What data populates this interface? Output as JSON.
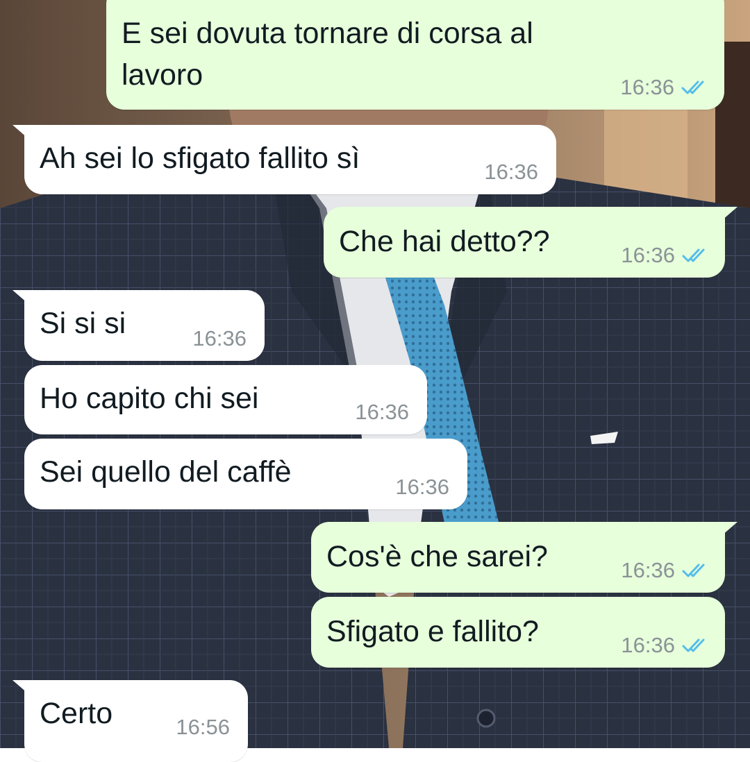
{
  "colors": {
    "outgoing_bubble": "#e7ffdb",
    "incoming_bubble": "#ffffff",
    "read_ticks": "#53bdeb",
    "timestamp": "#8a9296"
  },
  "messages": [
    {
      "direction": "out",
      "text_line1": "E sei dovuta tornare di corsa al",
      "text_line2": "lavoro",
      "time": "16:36",
      "status": "read",
      "status_icon": "double-check-icon"
    },
    {
      "direction": "in",
      "text": "Ah sei lo sfigato fallito sì",
      "time": "16:36"
    },
    {
      "direction": "out",
      "text": "Che hai detto??",
      "time": "16:36",
      "status": "read",
      "status_icon": "double-check-icon"
    },
    {
      "direction": "in",
      "text": "Si si si",
      "time": "16:36"
    },
    {
      "direction": "in",
      "text": "Ho capito chi sei",
      "time": "16:36"
    },
    {
      "direction": "in",
      "text": "Sei quello del caffè",
      "time": "16:36"
    },
    {
      "direction": "out",
      "text": "Cos'è che sarei?",
      "time": "16:36",
      "status": "read",
      "status_icon": "double-check-icon"
    },
    {
      "direction": "out",
      "text": "Sfigato e fallito?",
      "time": "16:36",
      "status": "read",
      "status_icon": "double-check-icon"
    },
    {
      "direction": "in",
      "text": "Certo",
      "time": "16:56"
    }
  ]
}
